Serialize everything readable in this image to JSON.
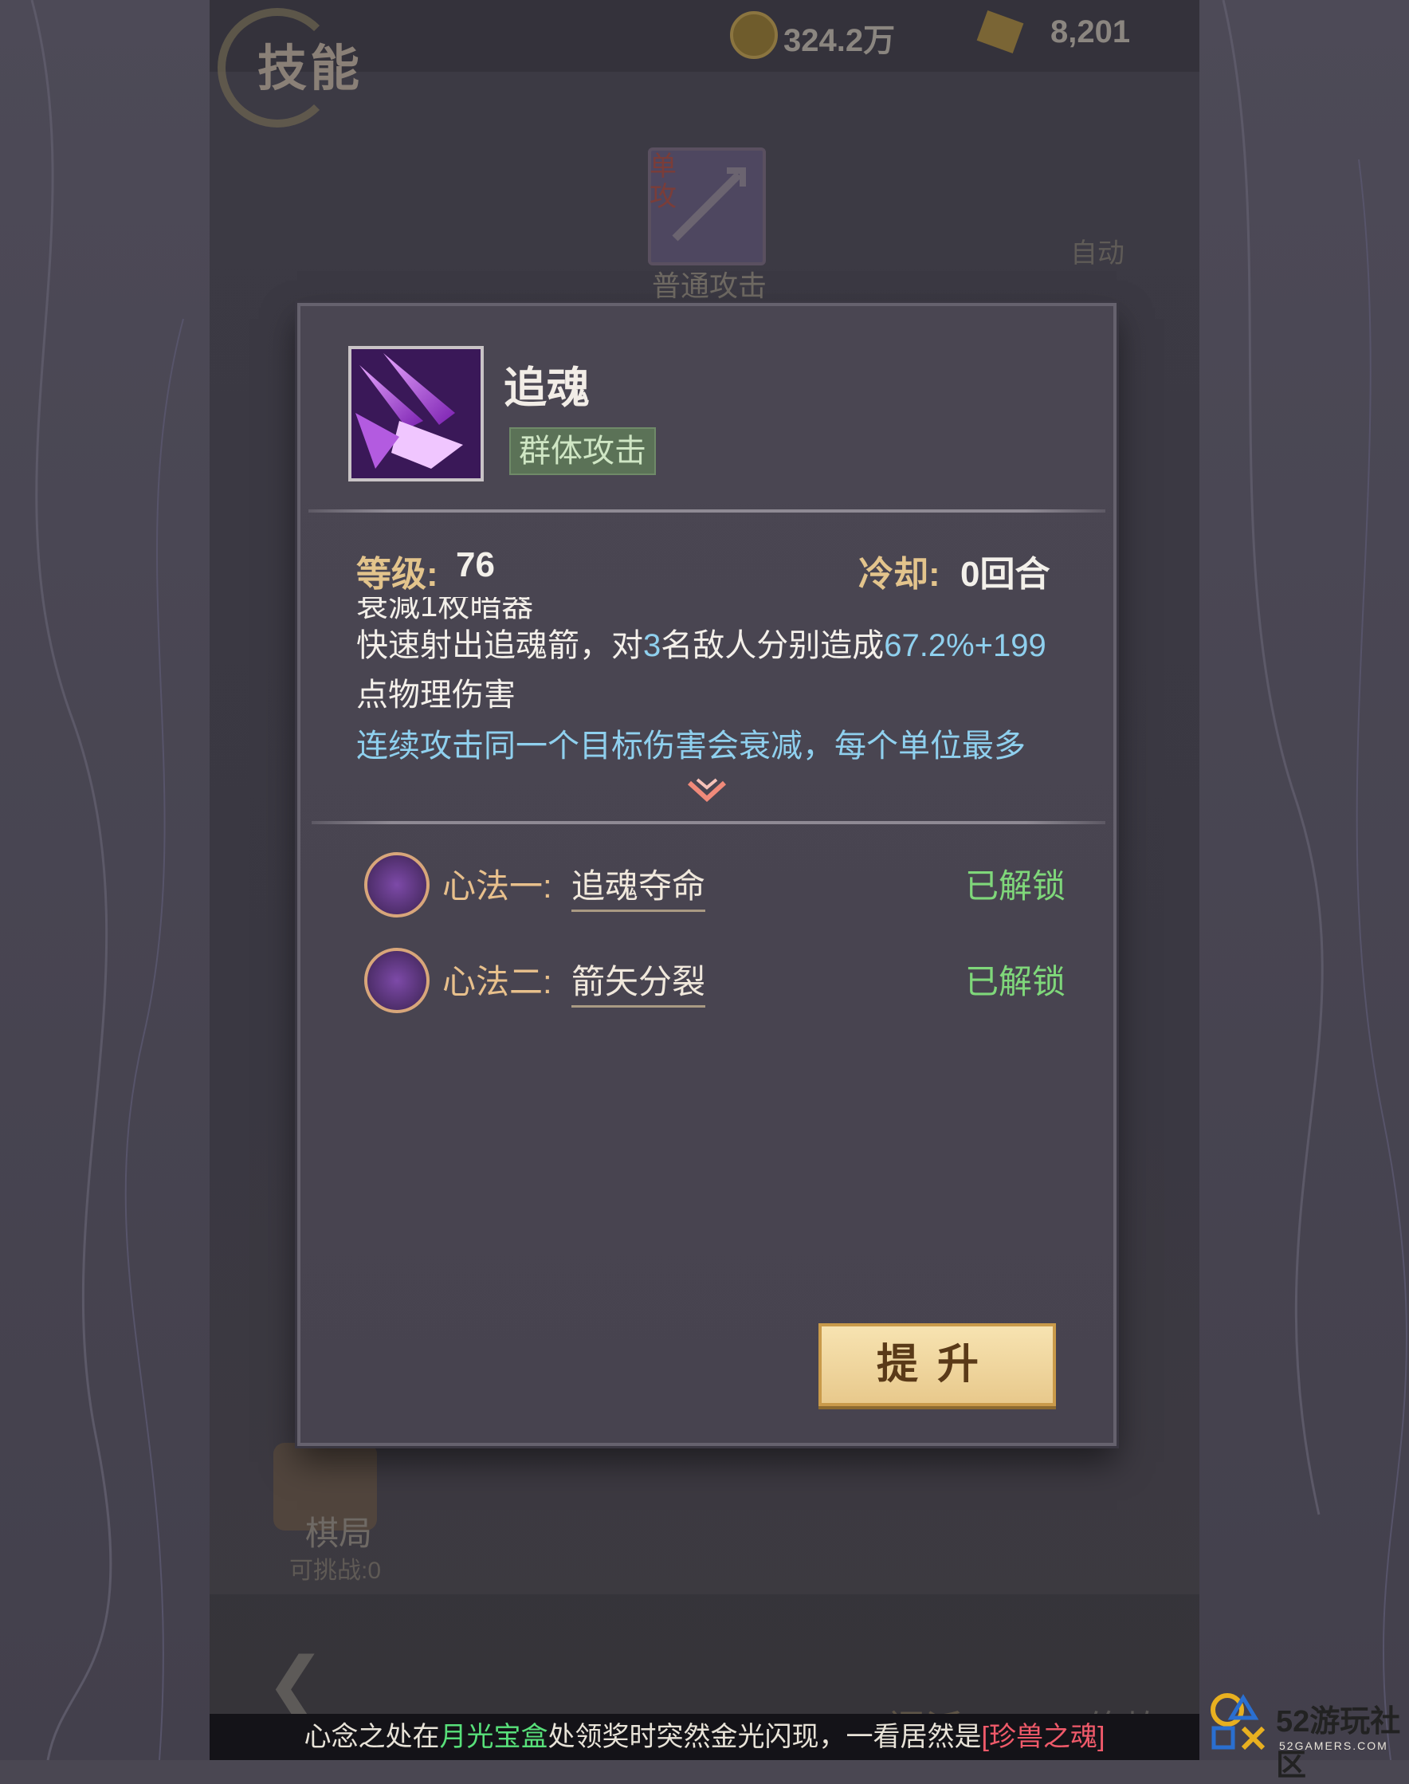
{
  "header": {
    "title": "技能",
    "gold_amount": "324.2万",
    "gem_amount": "8,201"
  },
  "top_skill": {
    "tag": "单攻",
    "label": "普通攻击"
  },
  "auto_label": "自动",
  "skill_panel": {
    "skill_name": "追魂",
    "skill_type": "群体攻击",
    "level_label": "等级:",
    "level_value": "76",
    "cooldown_label": "冷却:",
    "cooldown_value": "0回合",
    "desc_partial_top": "衰減1枚暗器",
    "desc_part1": "快速射出追魂箭，对",
    "desc_targets": "3",
    "desc_part2": "名敌人分别造成",
    "desc_value": "67.2%+199",
    "desc_part3": "点物理伤害",
    "desc_note": "连续攻击同一个目标伤害会衰减，每个单位最多",
    "methods": [
      {
        "label": "心法一:",
        "name": "追魂夺命",
        "status": "已解锁",
        "icon": "arrow-up-icon"
      },
      {
        "label": "心法二:",
        "name": "箭矢分裂",
        "status": "已解锁",
        "icon": "arrows-split-icon"
      }
    ],
    "upgrade_button": "提升"
  },
  "chess": {
    "label": "棋局",
    "sub": "可挑战:0"
  },
  "bottom_nav": {
    "sect": "门派",
    "train": "修炼"
  },
  "ticker": {
    "part1": "心念之处在",
    "place": "月光宝盒",
    "part2": "处领奖时突然金光闪现，一看居然是",
    "item": "[珍兽之魂]"
  },
  "watermark": {
    "brand": "52游玩社区",
    "site": "52GAMERS.COM"
  },
  "colors": {
    "accent_gold": "#e3c48c",
    "number_blue": "#8fd0ee",
    "unlocked_green": "#7fd77a"
  }
}
